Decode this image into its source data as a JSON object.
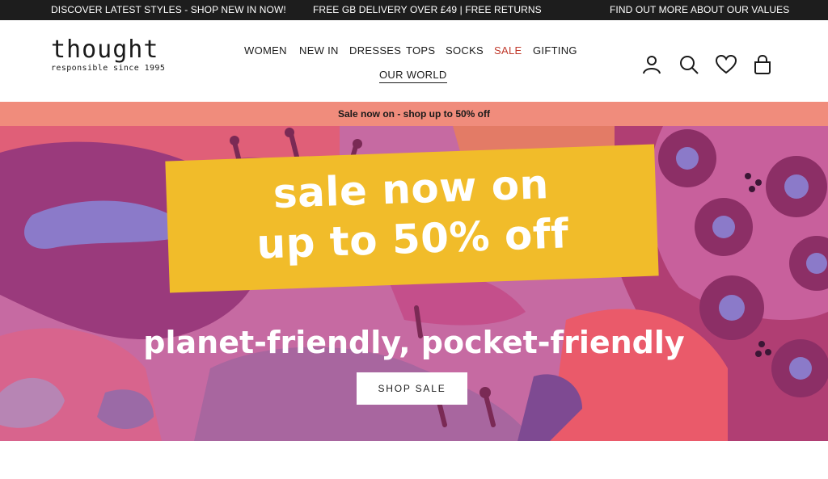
{
  "announcement": {
    "left": "DISCOVER LATEST STYLES - SHOP NEW IN NOW!",
    "center": "FREE GB DELIVERY OVER £49 | FREE RETURNS",
    "right": "FIND OUT MORE ABOUT OUR VALUES"
  },
  "brand": {
    "name": "thought",
    "tagline": "responsible since 1995"
  },
  "nav": {
    "items": [
      "WOMEN",
      "NEW IN",
      "DRESSES",
      "TOPS",
      "SOCKS",
      "SALE",
      "GIFTING"
    ],
    "secondary": "OUR WORLD"
  },
  "header_icons": [
    "account-icon",
    "search-icon",
    "heart-icon",
    "bag-icon"
  ],
  "sale_strip": "Sale now on - shop up to 50% off",
  "hero": {
    "headline_line1": "sale now on",
    "headline_line2": "up to 50% off",
    "tagline": "planet-friendly, pocket-friendly",
    "cta": "SHOP SALE"
  },
  "colors": {
    "announcement_bg": "#1d1d1d",
    "sale_strip_bg": "#f08c7c",
    "sale_link": "#c0392b",
    "banner_yellow": "#f1bc2a",
    "hero_pink": "#c66aa2"
  }
}
